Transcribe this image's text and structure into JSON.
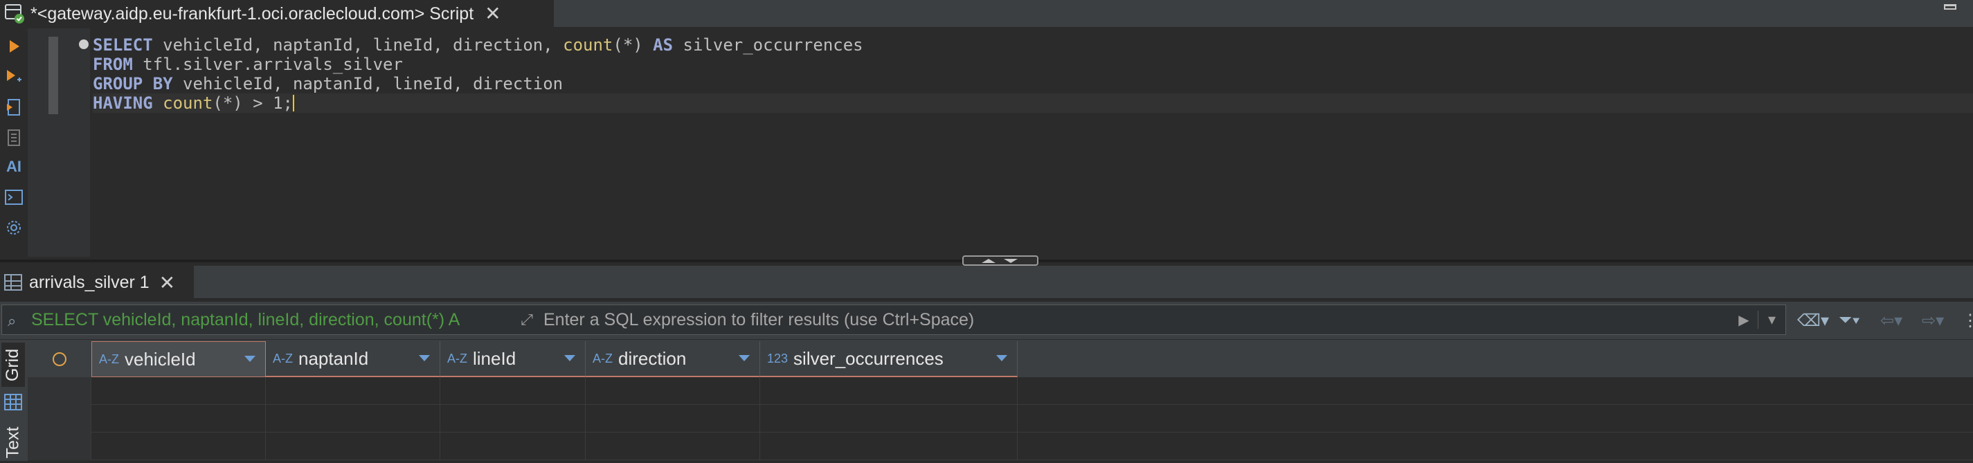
{
  "editor_tab": {
    "title": "*<gateway.aidp.eu-frankfurt-1.oci.oraclecloud.com> Script",
    "close_glyph": "✕"
  },
  "toolbar": {
    "items": [
      {
        "name": "execute-statement-icon",
        "glyph": "▶"
      },
      {
        "name": "execute-in-new-tab-icon",
        "glyph": "▶₊"
      },
      {
        "name": "execute-script-icon",
        "glyph": "⎙"
      },
      {
        "name": "explain-plan-icon",
        "glyph": "▤"
      },
      {
        "name": "ai-assistant-icon",
        "glyph": "AI"
      },
      {
        "name": "console-icon",
        "glyph": ">_"
      },
      {
        "name": "settings-icon",
        "glyph": "⚙"
      }
    ]
  },
  "code_lines": [
    [
      {
        "t": "SELECT",
        "c": "kw"
      },
      {
        "t": " vehicleId, naptanId, lineId, direction, ",
        "c": "plain"
      },
      {
        "t": "count",
        "c": "fn"
      },
      {
        "t": "(*) ",
        "c": "plain"
      },
      {
        "t": "AS",
        "c": "kw"
      },
      {
        "t": " silver_occurrences",
        "c": "plain"
      }
    ],
    [
      {
        "t": "FROM",
        "c": "kw"
      },
      {
        "t": " tfl.silver.arrivals_silver",
        "c": "plain"
      }
    ],
    [
      {
        "t": "GROUP BY",
        "c": "kw"
      },
      {
        "t": " vehicleId, naptanId, lineId, direction",
        "c": "plain"
      }
    ],
    [
      {
        "t": "HAVING",
        "c": "kw"
      },
      {
        "t": " ",
        "c": "plain"
      },
      {
        "t": "count",
        "c": "fn"
      },
      {
        "t": "(*) > 1;",
        "c": "plain"
      }
    ]
  ],
  "results_tab": {
    "label": "arrivals_silver 1",
    "close_glyph": "✕"
  },
  "filter": {
    "query": "SELECT vehicleId, naptanId, lineId, direction, count(*) A",
    "placeholder": "Enter a SQL expression to filter results (use Ctrl+Space)",
    "value": ""
  },
  "side_tabs": {
    "grid": "Grid",
    "text": "Text"
  },
  "columns": [
    {
      "type": "A-Z",
      "name": "vehicleId"
    },
    {
      "type": "A-Z",
      "name": "naptanId"
    },
    {
      "type": "A-Z",
      "name": "lineId"
    },
    {
      "type": "A-Z",
      "name": "direction"
    },
    {
      "type": "123",
      "name": "silver_occurrences"
    }
  ],
  "colors": {
    "keyword": "#9aa9d6",
    "function": "#d9c47a",
    "filter_query": "#4f9b45",
    "type_icon": "#6d9fd6"
  }
}
